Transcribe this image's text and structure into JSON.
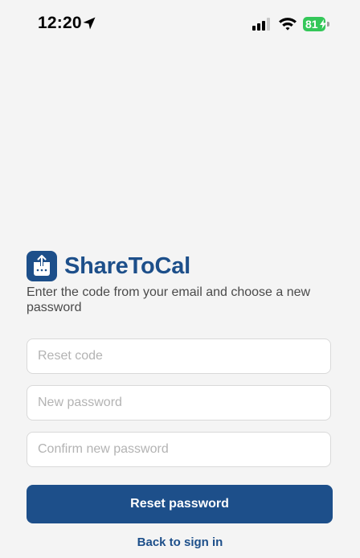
{
  "status_bar": {
    "time": "12:20",
    "battery_level": "81",
    "battery_color": "#34c759",
    "icons": [
      "location-arrow-icon",
      "cellular-signal-icon",
      "wifi-icon",
      "battery-charging-icon"
    ]
  },
  "brand": {
    "name": "ShareToCal",
    "logo_icon": "calendar-share-logo-icon",
    "color": "#1d4f8a"
  },
  "form": {
    "subtitle": "Enter the code from your email and choose a new password",
    "reset_code_placeholder": "Reset code",
    "new_password_placeholder": "New password",
    "confirm_password_placeholder": "Confirm new password",
    "submit_label": "Reset password",
    "back_link_label": "Back to sign in"
  }
}
